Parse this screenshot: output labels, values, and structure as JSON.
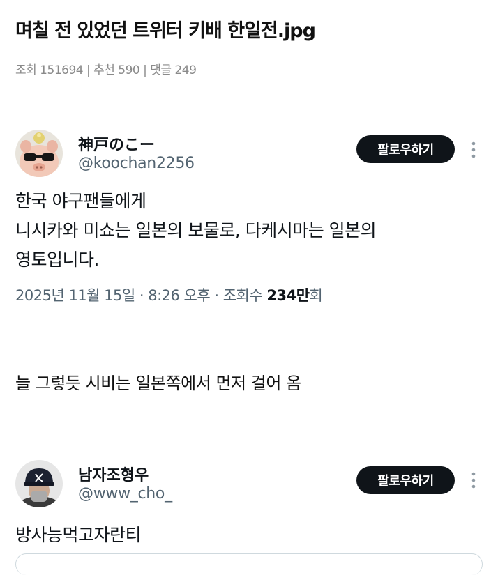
{
  "post": {
    "title": "며칠 전 있었던 트위터 키배 한일전.jpg",
    "meta": "조회 151694 | 추천 590 | 댓글 249"
  },
  "tweet1": {
    "display_name": "神戸のこー",
    "handle": "@koochan2256",
    "follow_label": "팔로우하기",
    "lines": [
      "한국 야구팬들에게",
      "니시카와 미쇼는 일본의 보물로, 다케시마는 일본의",
      "영토입니다."
    ],
    "meta_prefix": "2025년 11월 15일 · 8:26 오후 · 조회수 ",
    "views_bold": "234만",
    "views_suffix": "회"
  },
  "comment": "늘 그렇듯 시비는 일본쪽에서 먼저 걸어 옴",
  "tweet2": {
    "display_name": "남자조형우",
    "handle": "@www_cho_",
    "follow_label": "팔로우하기",
    "text": "방사능먹고자란티"
  },
  "icons": {
    "avatar1": "pig-with-sunglasses-avatar",
    "avatar2": "man-in-baseball-cap-avatar",
    "more": "vertical-ellipsis-icon"
  }
}
